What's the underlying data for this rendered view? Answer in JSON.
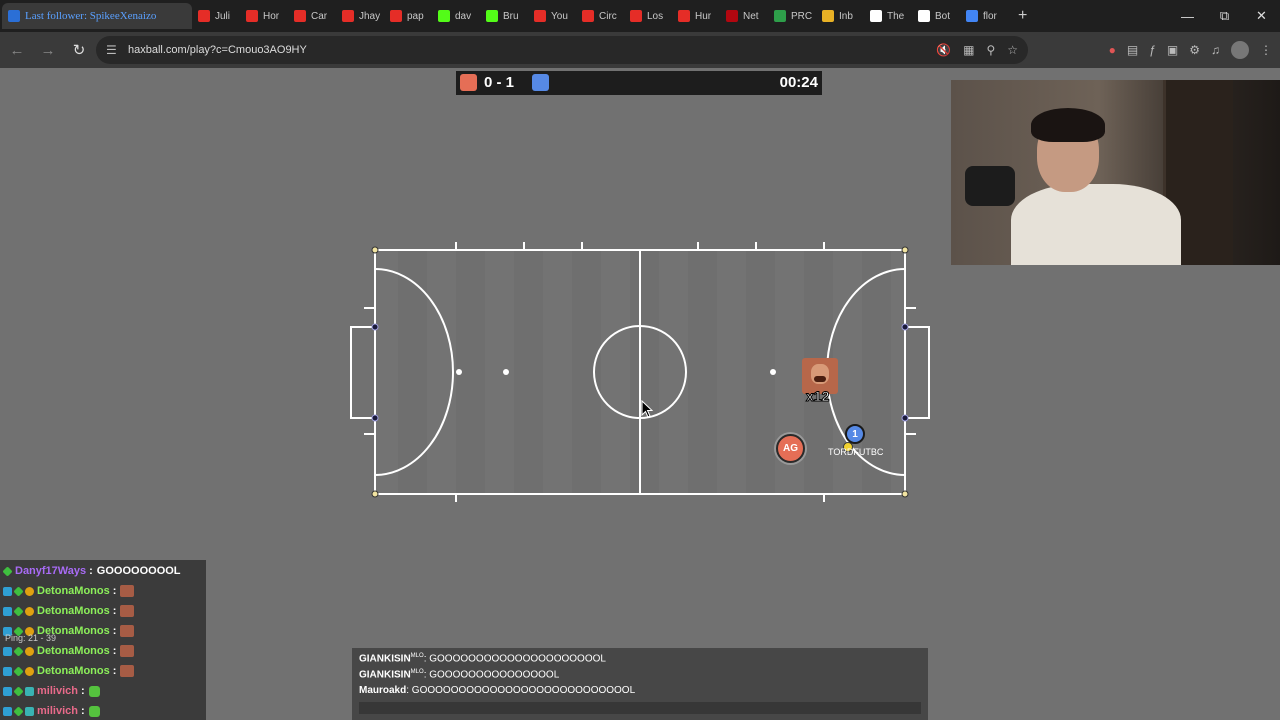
{
  "browser": {
    "tabs": [
      {
        "label": "Last follower: SpikeeXenaizo",
        "color": "#2b6fd6",
        "active": true
      },
      {
        "label": "Juli",
        "color": "#e52d27"
      },
      {
        "label": "Hor",
        "color": "#e52d27"
      },
      {
        "label": "Car",
        "color": "#e52d27"
      },
      {
        "label": "Jhay",
        "color": "#e52d27"
      },
      {
        "label": "pap",
        "color": "#e52d27"
      },
      {
        "label": "dav",
        "color": "#53fc18"
      },
      {
        "label": "Bru",
        "color": "#53fc18"
      },
      {
        "label": "You",
        "color": "#e52d27"
      },
      {
        "label": "Circ",
        "color": "#e52d27"
      },
      {
        "label": "Los",
        "color": "#e52d27"
      },
      {
        "label": "Hur",
        "color": "#e52d27"
      },
      {
        "label": "Net",
        "color": "#b20710"
      },
      {
        "label": "PRC",
        "color": "#2e9e4a"
      },
      {
        "label": "Inb",
        "color": "#e8b125"
      },
      {
        "label": "The",
        "color": "#ffffff"
      },
      {
        "label": "Bot",
        "color": "#ffffff"
      },
      {
        "label": "flor",
        "color": "#4285f4"
      }
    ],
    "new_tab": "+",
    "url": "haxball.com/play?c=Cmouo3AO9HY"
  },
  "game": {
    "score": "0 - 1",
    "timer": "00:24",
    "red_player_label": "AG",
    "blue_player_label": "1",
    "blue_player_name": "TORDFUTBC",
    "emote_count": "x12"
  },
  "left_chat": [
    {
      "name": "Danyf17Ways",
      "name_color": "#a86bf5",
      "msg": "GOOOOOOOOL",
      "badges": [
        "star"
      ]
    },
    {
      "name": "DetonaMonos",
      "name_color": "#8cf05a",
      "msg": "",
      "emote": "red",
      "badges": [
        "cube",
        "star",
        "coin"
      ]
    },
    {
      "name": "DetonaMonos",
      "name_color": "#8cf05a",
      "msg": "",
      "emote": "red",
      "badges": [
        "cube",
        "star",
        "coin"
      ]
    },
    {
      "name": "DetonaMonos",
      "name_color": "#8cf05a",
      "msg": "",
      "emote": "red",
      "badges": [
        "cube",
        "star",
        "coin"
      ]
    },
    {
      "name": "DetonaMonos",
      "name_color": "#8cf05a",
      "msg": "",
      "emote": "red",
      "badges": [
        "cube",
        "star",
        "coin"
      ]
    },
    {
      "name": "DetonaMonos",
      "name_color": "#8cf05a",
      "msg": "",
      "emote": "red",
      "badges": [
        "cube",
        "star",
        "coin"
      ]
    },
    {
      "name": "milivich",
      "name_color": "#e86a8a",
      "msg": "",
      "emote": "green",
      "badges": [
        "cube",
        "star",
        "sq2"
      ]
    },
    {
      "name": "milivich",
      "name_color": "#e86a8a",
      "msg": "",
      "emote": "green",
      "badges": [
        "cube",
        "star",
        "sq2"
      ]
    }
  ],
  "ping_text": "Ping: 21 - 39",
  "game_chat": [
    {
      "name": "GIANKISIN",
      "tag": "MLO",
      "msg": "GOOOOOOOOOOOOOOOOOOOOOL"
    },
    {
      "name": "GIANKISIN",
      "tag": "MLO",
      "msg": "GOOOOOOOOOOOOOOOL"
    },
    {
      "name": "Mauroakd",
      "tag": "",
      "msg": "GOOOOOOOOOOOOOOOOOOOOOOOOOOOL"
    }
  ]
}
